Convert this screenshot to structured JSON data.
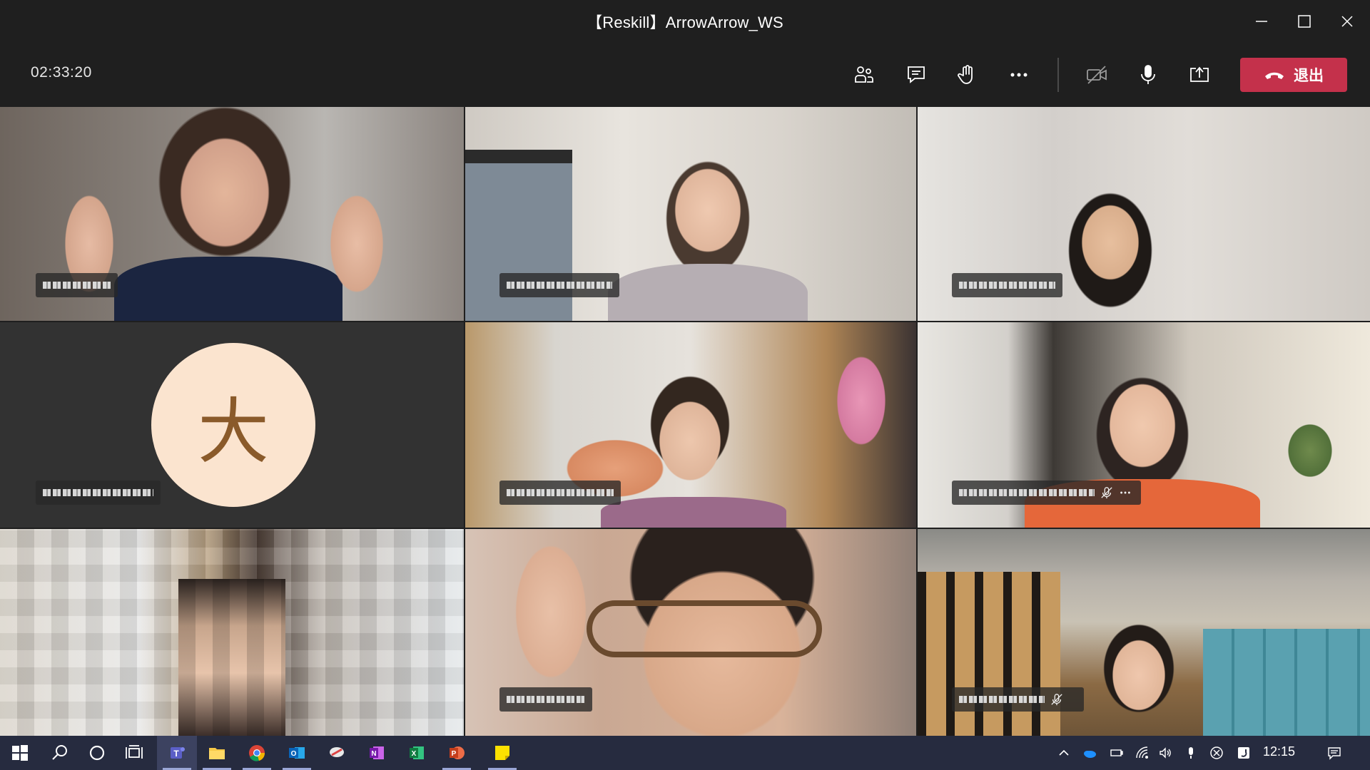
{
  "window": {
    "title": "【Reskill】ArrowArrow_WS"
  },
  "toolbar": {
    "timer": "02:33:20",
    "leave_label": "退出",
    "icons": [
      "participants-icon",
      "chat-icon",
      "raise-hand-icon",
      "more-icon",
      "camera-off-icon",
      "microphone-icon",
      "share-screen-icon",
      "hang-up-icon"
    ]
  },
  "tiles": [
    {
      "id": "tile-1",
      "type": "video",
      "muted": false,
      "more": false
    },
    {
      "id": "tile-2",
      "type": "video",
      "muted": false,
      "more": false
    },
    {
      "id": "tile-3",
      "type": "video",
      "muted": false,
      "more": false
    },
    {
      "id": "tile-4",
      "type": "avatar",
      "avatar_text": "大",
      "muted": false,
      "more": false
    },
    {
      "id": "tile-5",
      "type": "video",
      "muted": false,
      "more": false
    },
    {
      "id": "tile-6",
      "type": "video",
      "muted": true,
      "more": true
    },
    {
      "id": "tile-7",
      "type": "video-pixelated",
      "muted": false,
      "more": false
    },
    {
      "id": "tile-8",
      "type": "video",
      "muted": false,
      "more": false
    },
    {
      "id": "tile-9",
      "type": "video",
      "muted": true,
      "more": false
    }
  ],
  "taskbar": {
    "apps": [
      "start-icon",
      "search-icon",
      "cortana-icon",
      "task-view-icon",
      "teams-icon",
      "file-explorer-icon",
      "chrome-icon",
      "outlook-icon",
      "snip-icon",
      "onenote-icon",
      "excel-icon",
      "powerpoint-icon",
      "sticky-notes-icon"
    ],
    "clock": "12:15"
  },
  "colors": {
    "leave": "#c4314b",
    "background": "#1f1f1f",
    "taskbar": "#262b3f",
    "avatar_bg": "#fbe4cf"
  }
}
